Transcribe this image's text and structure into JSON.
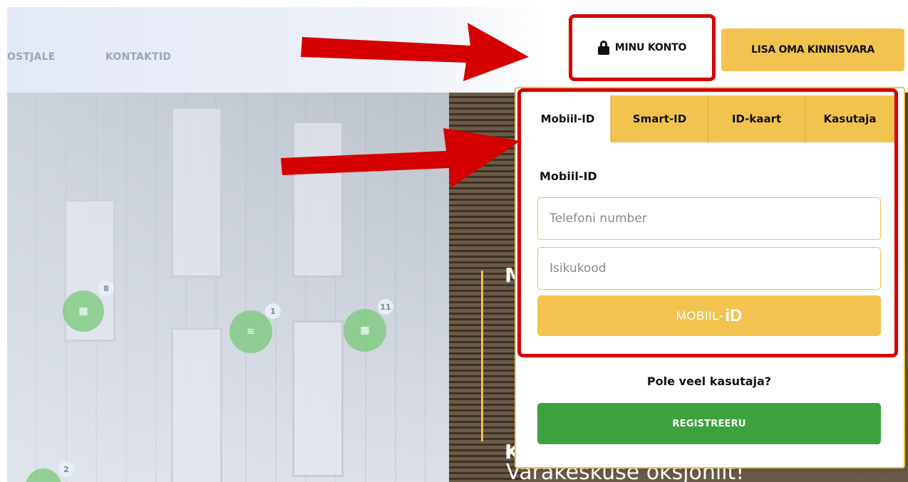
{
  "nav": {
    "items": [
      {
        "label": "OSTJALE"
      },
      {
        "label": "KONTAKTID"
      }
    ]
  },
  "header": {
    "account_label": "MINU KONTO",
    "add_property_label": "LISA OMA KINNISVARA"
  },
  "login_panel": {
    "tabs": [
      {
        "label": "Mobiil-ID",
        "active": true
      },
      {
        "label": "Smart-ID",
        "active": false
      },
      {
        "label": "ID-kaart",
        "active": false
      },
      {
        "label": "Kasutaja",
        "active": false
      }
    ],
    "form_title": "Mobiil-ID",
    "phone_placeholder": "Telefoni number",
    "idcode_placeholder": "Isikukood",
    "submit_text": "MOBIIL-",
    "submit_logo": "iD",
    "signup_question": "Pole veel kasutaja?",
    "register_label": "REGISTREERU"
  },
  "hero": {
    "text_a": "M",
    "text_b": "K",
    "bottom_text": "Varakeskuse oksjonilt!"
  },
  "map_pins": [
    {
      "count": "8"
    },
    {
      "count": "1"
    },
    {
      "count": "11"
    },
    {
      "count": "2"
    }
  ],
  "colors": {
    "accent_yellow": "#f2c44f",
    "register_green": "#3da13d",
    "annotation_red": "#d40000"
  }
}
